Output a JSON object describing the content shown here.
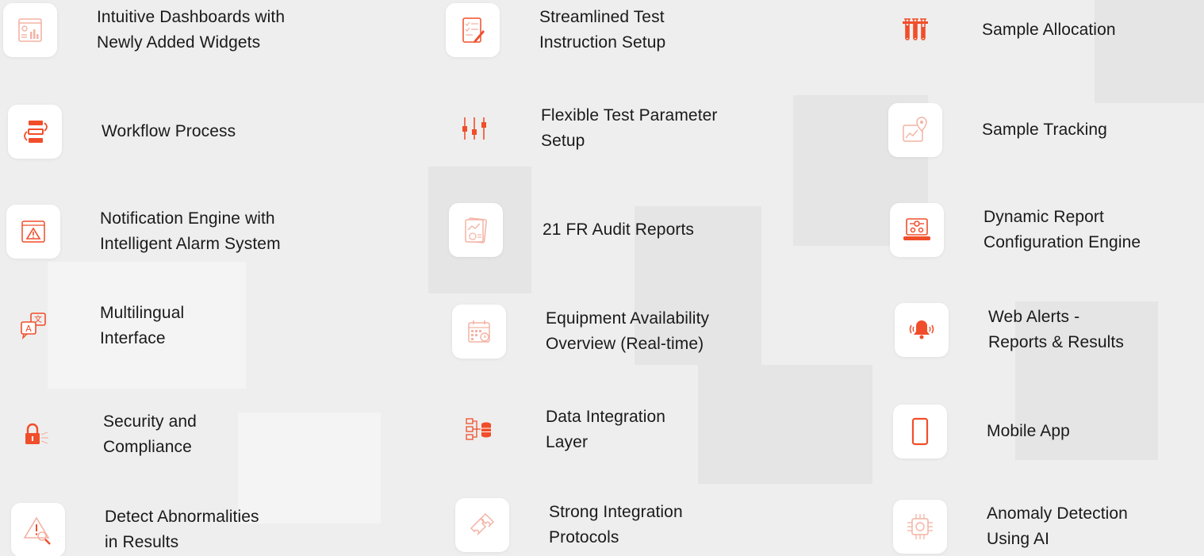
{
  "accent": "#f04e2a",
  "features": [
    {
      "icon": "dashboard-icon",
      "lines": [
        "Intuitive Dashboards with",
        "Newly Added Widgets"
      ]
    },
    {
      "icon": "test-instruction-icon",
      "lines": [
        "Streamlined Test",
        "Instruction Setup"
      ]
    },
    {
      "icon": "test-tubes-icon",
      "lines": [
        "Sample Allocation"
      ]
    },
    {
      "icon": "workflow-icon",
      "lines": [
        "Workflow Process"
      ]
    },
    {
      "icon": "parameter-sliders-icon",
      "lines": [
        "Flexible Test Parameter",
        "Setup"
      ]
    },
    {
      "icon": "sample-tracking-icon",
      "lines": [
        "Sample Tracking"
      ]
    },
    {
      "icon": "alarm-warning-icon",
      "lines": [
        "Notification Engine with",
        "Intelligent Alarm System"
      ]
    },
    {
      "icon": "audit-report-icon",
      "lines": [
        "21 FR Audit Reports"
      ]
    },
    {
      "icon": "report-config-icon",
      "lines": [
        "Dynamic Report",
        "Configuration Engine"
      ]
    },
    {
      "icon": "translate-icon",
      "lines": [
        "Multilingual",
        "Interface"
      ]
    },
    {
      "icon": "calendar-clock-icon",
      "lines": [
        "Equipment Availability",
        "Overview (Real-time)"
      ]
    },
    {
      "icon": "bell-alert-icon",
      "lines": [
        "Web Alerts -",
        "Reports & Results"
      ]
    },
    {
      "icon": "lock-icon",
      "lines": [
        "Security and",
        "Compliance"
      ]
    },
    {
      "icon": "data-integration-icon",
      "lines": [
        "Data Integration",
        "Layer"
      ]
    },
    {
      "icon": "mobile-phone-icon",
      "lines": [
        "Mobile App"
      ]
    },
    {
      "icon": "abnormality-search-icon",
      "lines": [
        "Detect Abnormalities",
        "in Results"
      ]
    },
    {
      "icon": "puzzle-icon",
      "lines": [
        "Strong Integration",
        "Protocols"
      ]
    },
    {
      "icon": "ai-chip-icon",
      "lines": [
        "Anomaly Detection",
        "Using AI"
      ]
    }
  ]
}
